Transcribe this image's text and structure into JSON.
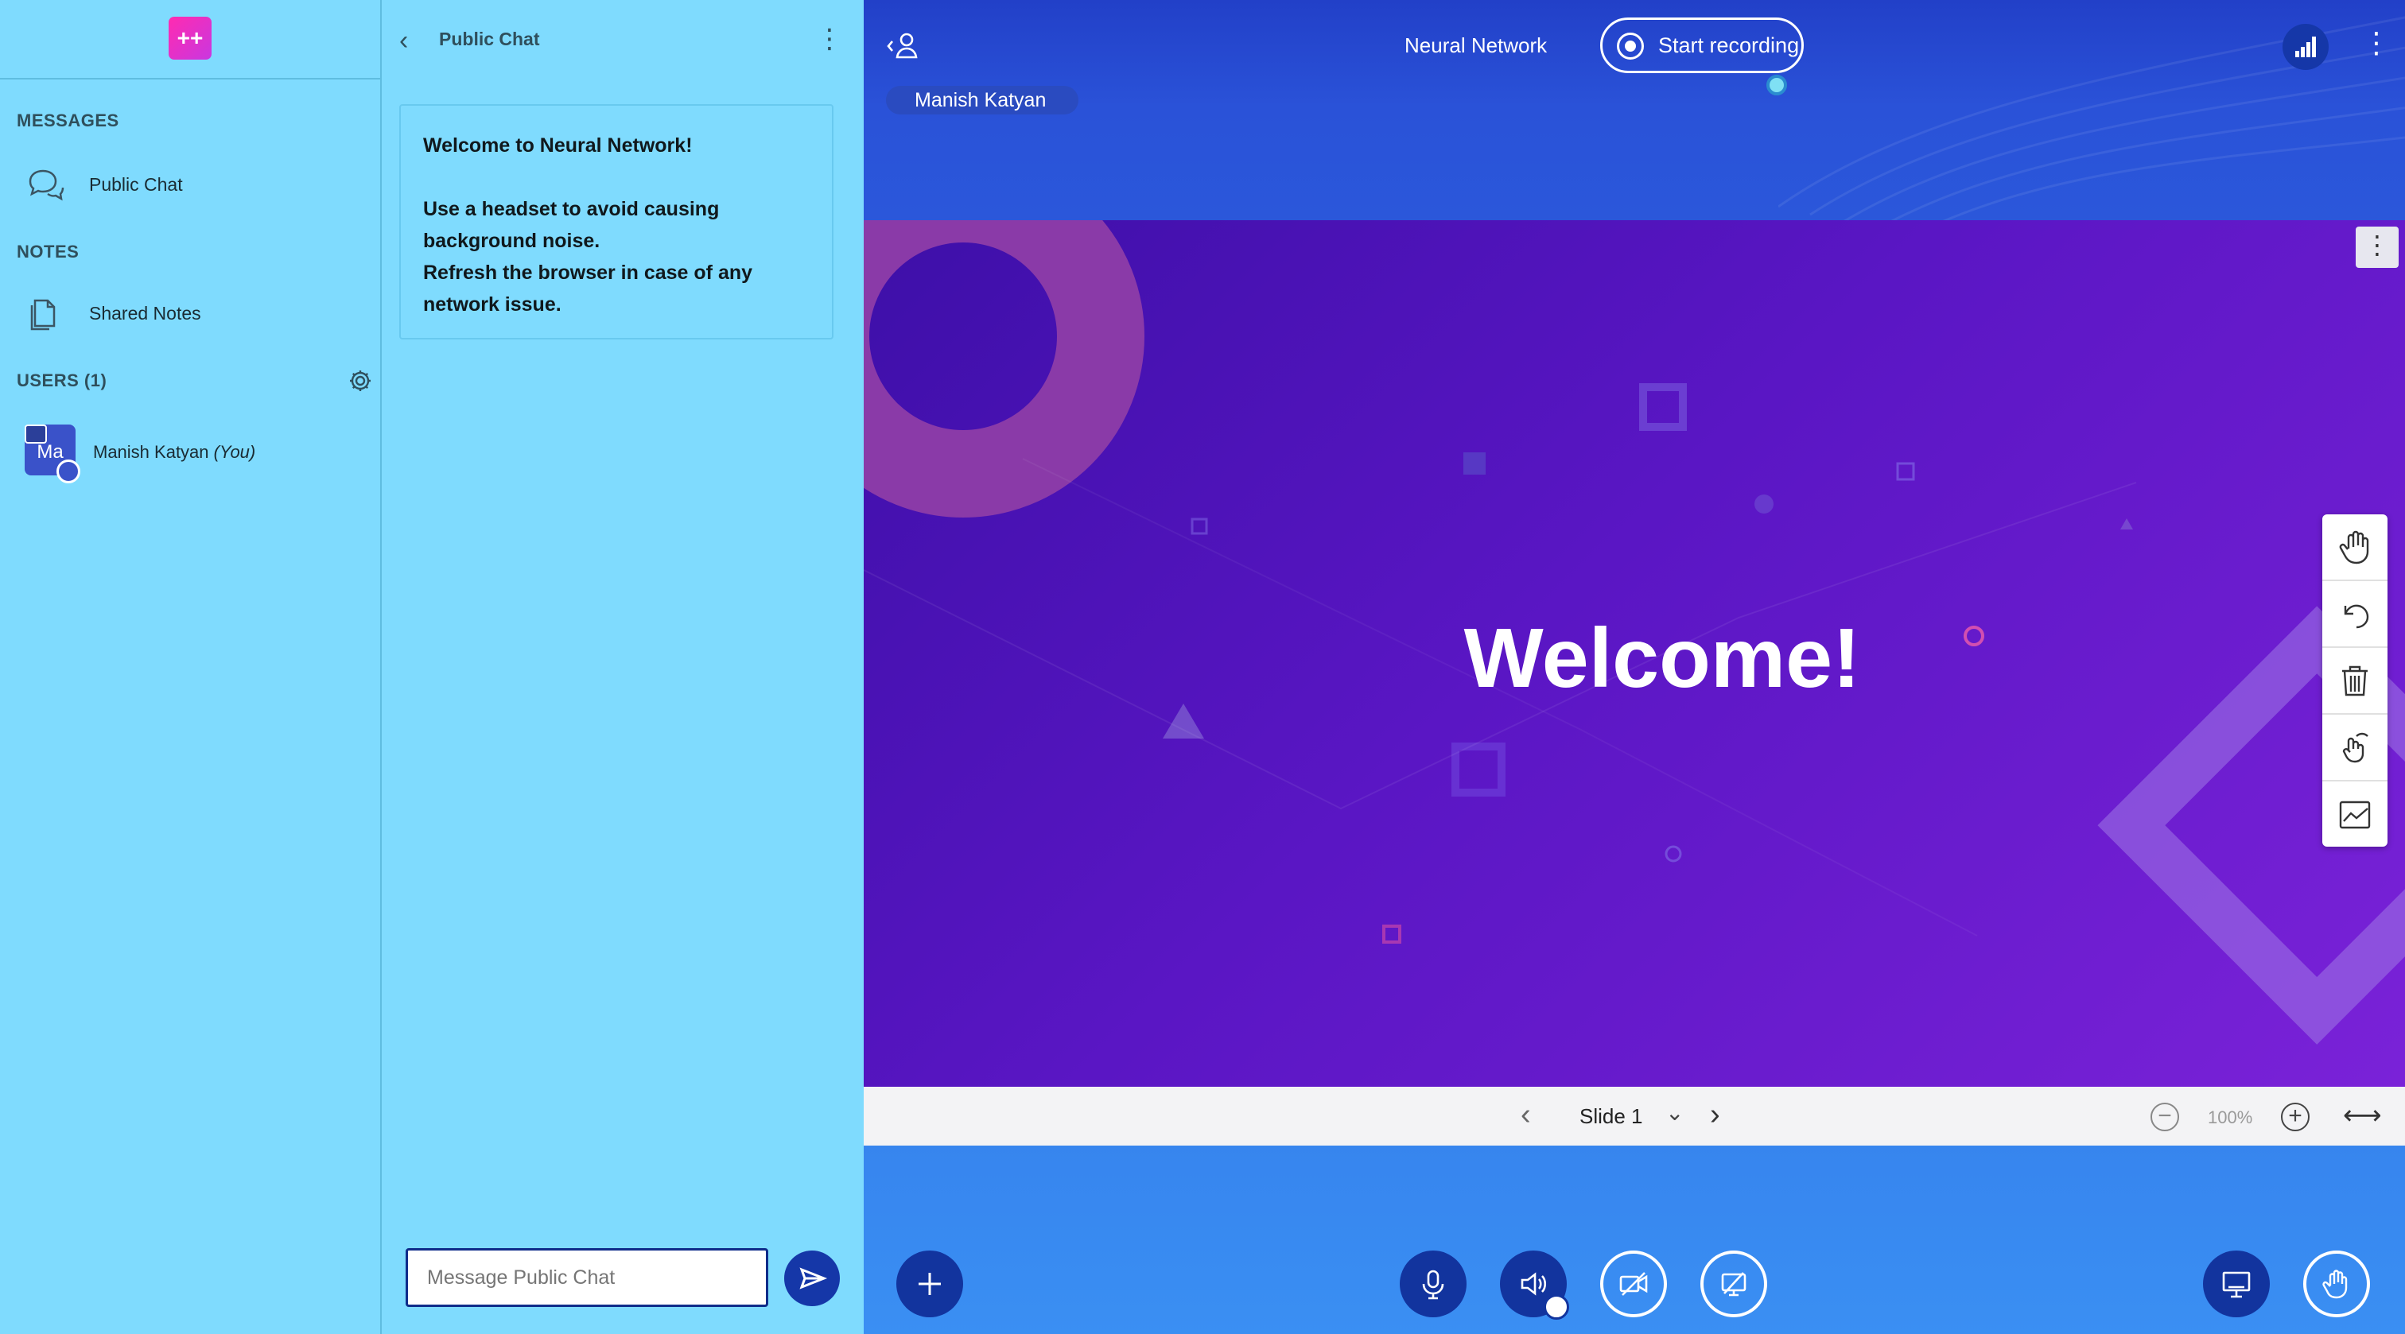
{
  "app": {
    "logo_text": "++"
  },
  "sidebar": {
    "messages_title": "MESSAGES",
    "public_chat_label": "Public Chat",
    "notes_title": "NOTES",
    "shared_notes_label": "Shared Notes",
    "users_title": "USERS (1)",
    "users": [
      {
        "initials": "Ma",
        "name": "Manish Katyan",
        "suffix": "(You)"
      }
    ]
  },
  "chat": {
    "title": "Public Chat",
    "welcome_prefix": "Welcome to ",
    "welcome_room": "Neural Network",
    "welcome_suffix": "!",
    "tip_1": "Use a headset to avoid causing background noise.",
    "tip_2": "Refresh the browser in case of any network issue.",
    "input_placeholder": "Message Public Chat"
  },
  "header": {
    "room_title": "Neural Network",
    "record_label": "Start recording",
    "talking_user": "Manish Katyan"
  },
  "presentation": {
    "slide_title": "Welcome!",
    "slide_label": "Slide 1",
    "zoom": "100%"
  },
  "colors": {
    "sidebar_bg": "#7fdbfe",
    "accent": "#12349e",
    "slide_bg": "#5a16c4",
    "logo": "#ff2bb0"
  },
  "icons": {
    "whiteboard_tools": [
      "hand-icon",
      "undo-icon",
      "trash-icon",
      "multi-user-pen-icon",
      "chart-icon"
    ],
    "actions": [
      "plus-icon",
      "microphone-icon",
      "speaker-icon",
      "camera-off-icon",
      "screenshare-off-icon",
      "presentation-icon",
      "raise-hand-icon"
    ]
  }
}
